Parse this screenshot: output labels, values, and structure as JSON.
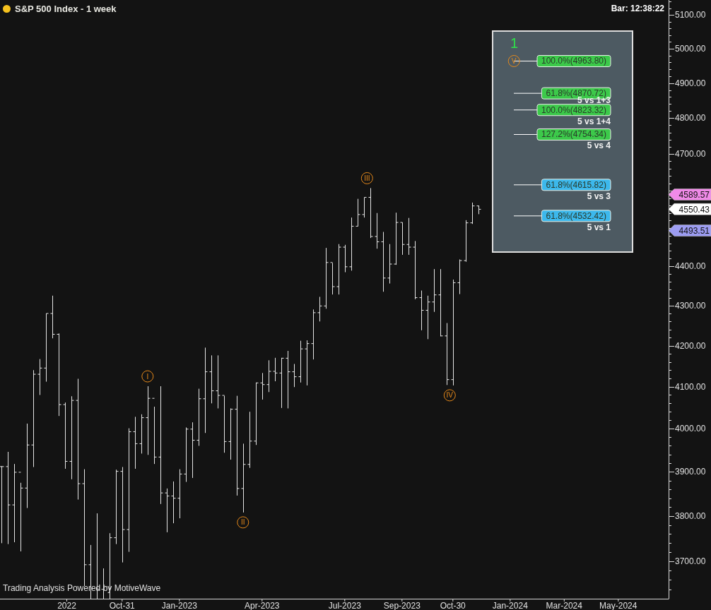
{
  "title": "S&P 500 Index - 1 week",
  "clock": "Bar: 12:38:22",
  "footer": "Trading Analysis Powered by MotiveWave",
  "price_axis": {
    "labels": [
      "5100.00",
      "5000.00",
      "4900.00",
      "4800.00",
      "4700.00",
      "4400.00",
      "4300.00",
      "4200.00",
      "4100.00",
      "4000.00",
      "3900.00",
      "3800.00",
      "3700.00"
    ]
  },
  "time_axis": {
    "labels": [
      "2022",
      "Oct-31",
      "Jan-2023",
      "Apr-2023",
      "Jul-2023",
      "Sep-2023",
      "Oct-30",
      "Jan-2024",
      "Mar-2024",
      "May-2024"
    ]
  },
  "wave_labels": [
    "I",
    "II",
    "III",
    "IV",
    "V"
  ],
  "projection_panel": {
    "title": "1",
    "targets": [
      {
        "text": "100.0%(4963.80)",
        "color": "#3cc94a"
      },
      {
        "text": "61.8%(4870.72)",
        "caption": "5 vs 1+3",
        "color": "#3cc94a"
      },
      {
        "text": "100.0%(4823.32)",
        "caption": "5 vs 1+4",
        "color": "#3cc94a"
      },
      {
        "text": "127.2%(4754.34)",
        "caption": "5 vs 4",
        "color": "#3cc94a"
      },
      {
        "text": "61.8%(4615.82)",
        "caption": "5 vs 3",
        "color": "#3cb8ec"
      },
      {
        "text": "61.8%(4532.42)",
        "caption": "5 vs 1",
        "color": "#3cb8ec"
      }
    ]
  },
  "price_tags": [
    {
      "text": "4589.57",
      "color": "#f08ae8"
    },
    {
      "text": "4550.43",
      "color": "#ffffff"
    },
    {
      "text": "4493.51",
      "color": "#9c9cf2"
    }
  ]
}
